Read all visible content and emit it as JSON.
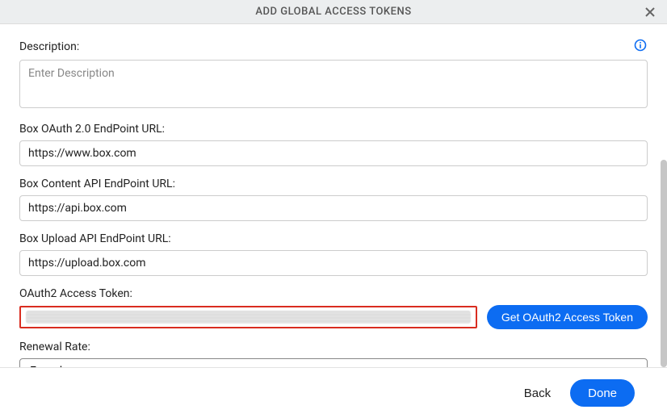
{
  "header": {
    "title": "ADD GLOBAL ACCESS TOKENS"
  },
  "form": {
    "description": {
      "label": "Description:",
      "placeholder": "Enter Description",
      "value": ""
    },
    "box_oauth_endpoint": {
      "label": "Box OAuth 2.0 EndPoint URL:",
      "value": "https://www.box.com"
    },
    "box_content_api_endpoint": {
      "label": "Box Content API EndPoint URL:",
      "value": "https://api.box.com"
    },
    "box_upload_api_endpoint": {
      "label": "Box Upload API EndPoint URL:",
      "value": "https://upload.box.com"
    },
    "oauth2_access_token": {
      "label": "OAuth2 Access Token:",
      "button": "Get OAuth2 Access Token"
    },
    "renewal_rate": {
      "label": "Renewal Rate:",
      "selected": "Every hour"
    }
  },
  "footer": {
    "back": "Back",
    "done": "Done"
  }
}
